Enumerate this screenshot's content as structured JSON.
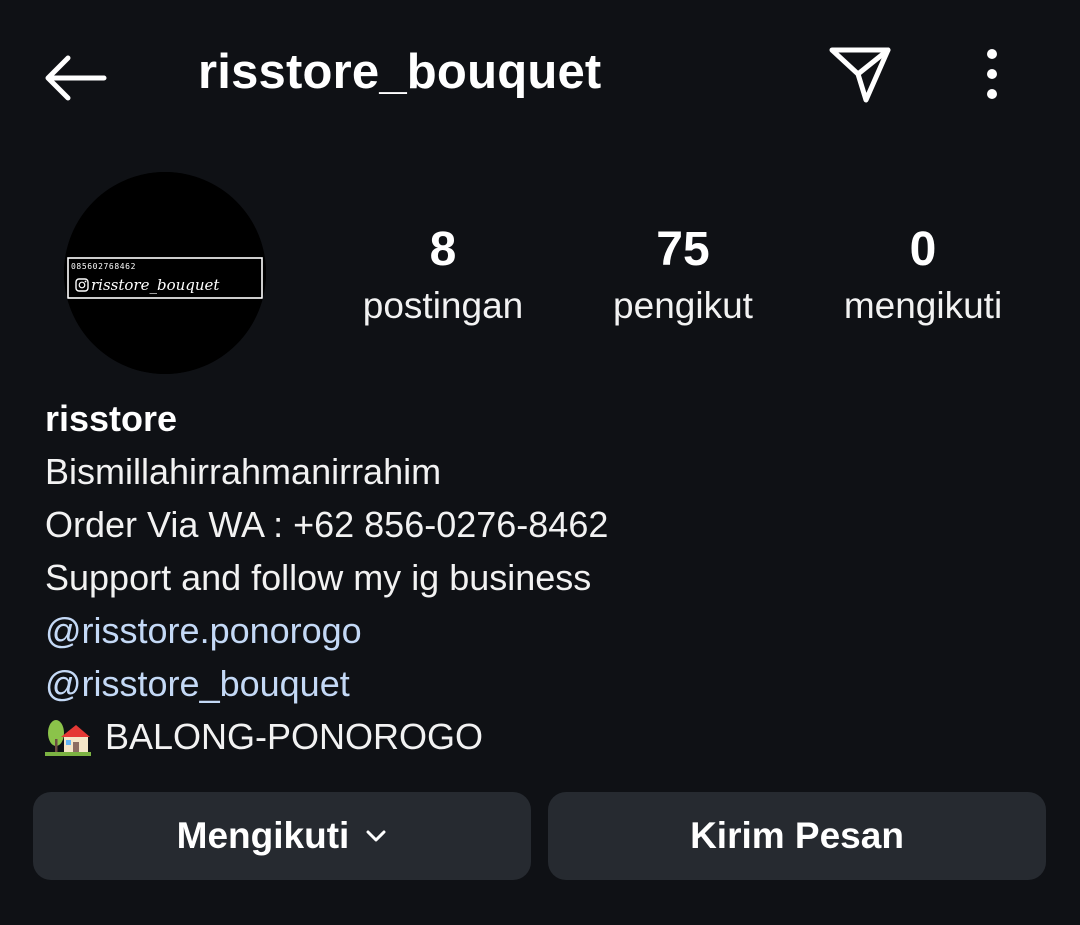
{
  "header": {
    "username": "risstore_bouquet",
    "back_icon": "arrow-left-icon",
    "share_icon": "paper-plane-icon",
    "more_icon": "more-vertical-icon"
  },
  "avatar": {
    "phone_text": "085602768462",
    "logo_text": "risstore_bouquet"
  },
  "stats": {
    "posts": {
      "value": "8",
      "label": "postingan"
    },
    "followers": {
      "value": "75",
      "label": "pengikut"
    },
    "following": {
      "value": "0",
      "label": "mengikuti"
    }
  },
  "bio": {
    "name": "risstore",
    "line1": "Bismillahirrahmanirrahim",
    "line2": "Order Via WA : +62 856-0276-8462",
    "line3": "Support and follow my ig business",
    "link1": "@risstore.ponorogo",
    "link2": "@risstore_bouquet",
    "location_icon": "house-with-garden-icon",
    "location": "BALONG-PONOROGO"
  },
  "actions": {
    "follow_label": "Mengikuti",
    "follow_icon": "chevron-down-icon",
    "message_label": "Kirim Pesan"
  },
  "colors": {
    "background": "#0f1115",
    "button_bg": "#262a30",
    "link": "#c4d9f6",
    "text": "#f5f5f5"
  }
}
